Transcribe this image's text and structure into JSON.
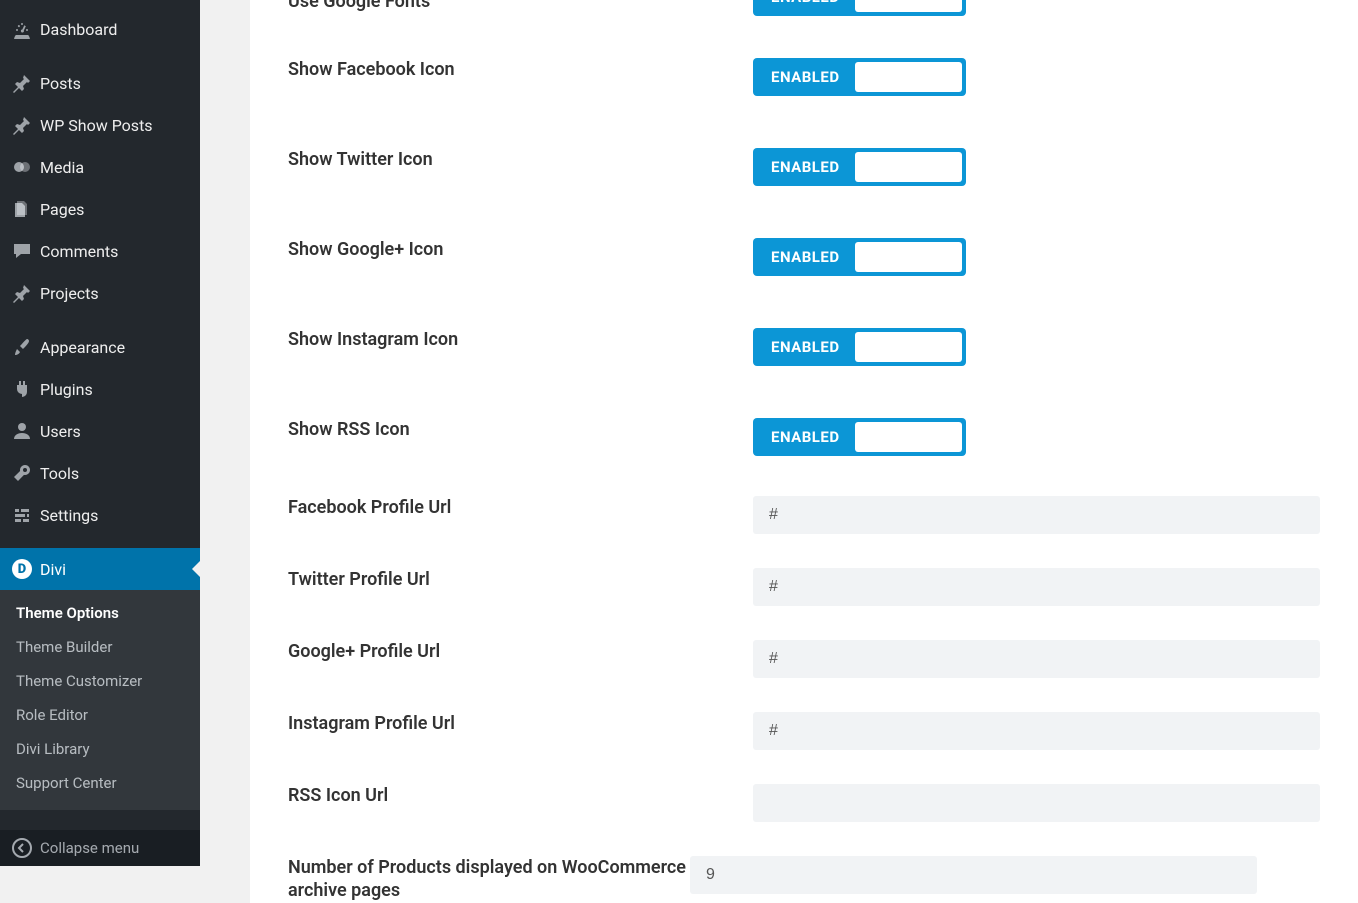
{
  "sidebar": {
    "items": [
      {
        "icon": "dashboard",
        "label": "Dashboard"
      },
      {
        "icon": "pin",
        "label": "Posts"
      },
      {
        "icon": "pin",
        "label": "WP Show Posts"
      },
      {
        "icon": "media",
        "label": "Media"
      },
      {
        "icon": "pages",
        "label": "Pages"
      },
      {
        "icon": "comment",
        "label": "Comments"
      },
      {
        "icon": "pin",
        "label": "Projects"
      },
      {
        "icon": "brush",
        "label": "Appearance"
      },
      {
        "icon": "plug",
        "label": "Plugins"
      },
      {
        "icon": "user",
        "label": "Users"
      },
      {
        "icon": "wrench",
        "label": "Tools"
      },
      {
        "icon": "sliders",
        "label": "Settings"
      },
      {
        "icon": "divi",
        "label": "Divi"
      }
    ],
    "submenu": [
      "Theme Options",
      "Theme Builder",
      "Theme Customizer",
      "Role Editor",
      "Divi Library",
      "Support Center"
    ],
    "collapse_label": "Collapse menu"
  },
  "options": {
    "toggles": [
      {
        "key": "use_google_fonts",
        "label": "Use Google Fonts",
        "state": "ENABLED"
      },
      {
        "key": "show_facebook_icon",
        "label": "Show Facebook Icon",
        "state": "ENABLED"
      },
      {
        "key": "show_twitter_icon",
        "label": "Show Twitter Icon",
        "state": "ENABLED"
      },
      {
        "key": "show_googleplus_icon",
        "label": "Show Google+ Icon",
        "state": "ENABLED"
      },
      {
        "key": "show_instagram_icon",
        "label": "Show Instagram Icon",
        "state": "ENABLED"
      },
      {
        "key": "show_rss_icon",
        "label": "Show RSS Icon",
        "state": "ENABLED"
      }
    ],
    "text_fields": [
      {
        "key": "facebook_url",
        "label": "Facebook Profile Url",
        "value": "#"
      },
      {
        "key": "twitter_url",
        "label": "Twitter Profile Url",
        "value": "#"
      },
      {
        "key": "googleplus_url",
        "label": "Google+ Profile Url",
        "value": "#"
      },
      {
        "key": "instagram_url",
        "label": "Instagram Profile Url",
        "value": "#"
      },
      {
        "key": "rss_url",
        "label": "RSS Icon Url",
        "value": ""
      },
      {
        "key": "woo_products",
        "label": "Number of Products displayed on WooCommerce archive pages",
        "value": "9"
      }
    ]
  }
}
